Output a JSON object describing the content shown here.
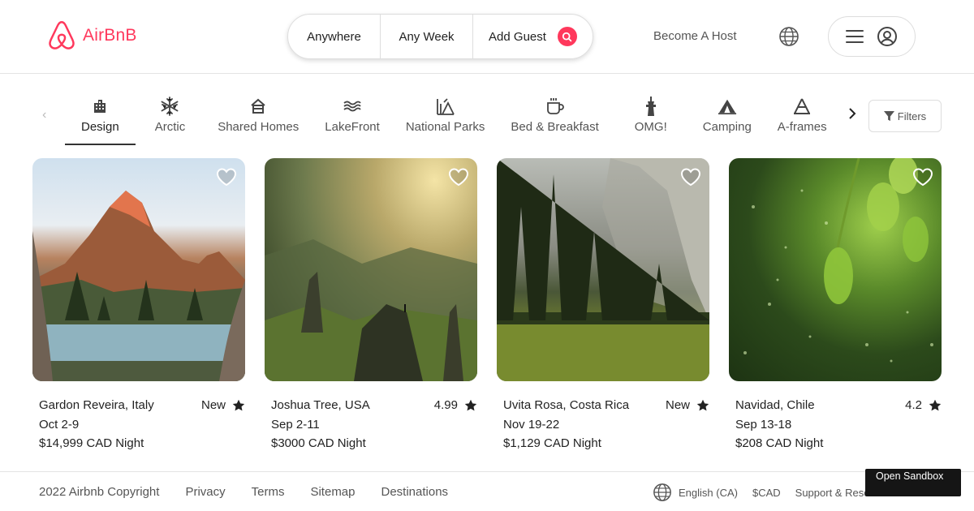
{
  "brand": {
    "name": "AirBnB",
    "color": "#ff385c"
  },
  "search": {
    "where": "Anywhere",
    "when": "Any Week",
    "guests": "Add Guest",
    "icon": "search-icon"
  },
  "header": {
    "host_label": "Become A Host",
    "language_icon": "globe-icon",
    "menu_icon": "hamburger-icon",
    "profile_icon": "user-circle-icon"
  },
  "categories": {
    "items": [
      {
        "label": "Design",
        "icon": "building-icon",
        "active": true
      },
      {
        "label": "Arctic",
        "icon": "snowflake-icon"
      },
      {
        "label": "Shared Homes",
        "icon": "home-icon"
      },
      {
        "label": "LakeFront",
        "icon": "water-icon"
      },
      {
        "label": "National Parks",
        "icon": "park-icon"
      },
      {
        "label": "Bed & Breakfast",
        "icon": "mug-icon"
      },
      {
        "label": "OMG!",
        "icon": "tower-icon"
      },
      {
        "label": "Camping",
        "icon": "tent-icon"
      },
      {
        "label": "A-frames",
        "icon": "a-frame-icon"
      }
    ],
    "filters_label": "Filters"
  },
  "listings": [
    {
      "location": "Gardon Reveira, Italy",
      "rating": "New",
      "dates": "Oct 2-9",
      "price": "$14,999 CAD Night"
    },
    {
      "location": "Joshua Tree, USA",
      "rating": "4.99",
      "dates": "Sep 2-11",
      "price": "$3000 CAD Night"
    },
    {
      "location": "Uvita Rosa, Costa Rica",
      "rating": "New",
      "dates": "Nov 19-22",
      "price": "$1,129 CAD Night"
    },
    {
      "location": "Navidad, Chile",
      "rating": "4.2",
      "dates": "Sep 13-18",
      "price": "$208 CAD Night"
    }
  ],
  "footer": {
    "copyright": "2022 Airbnb Copyright",
    "links": [
      "Privacy",
      "Terms",
      "Sitemap",
      "Destinations"
    ],
    "language": "English (CA)",
    "currency": "$CAD",
    "support": "Support & Resources"
  },
  "sandbox_label": "Open Sandbox"
}
